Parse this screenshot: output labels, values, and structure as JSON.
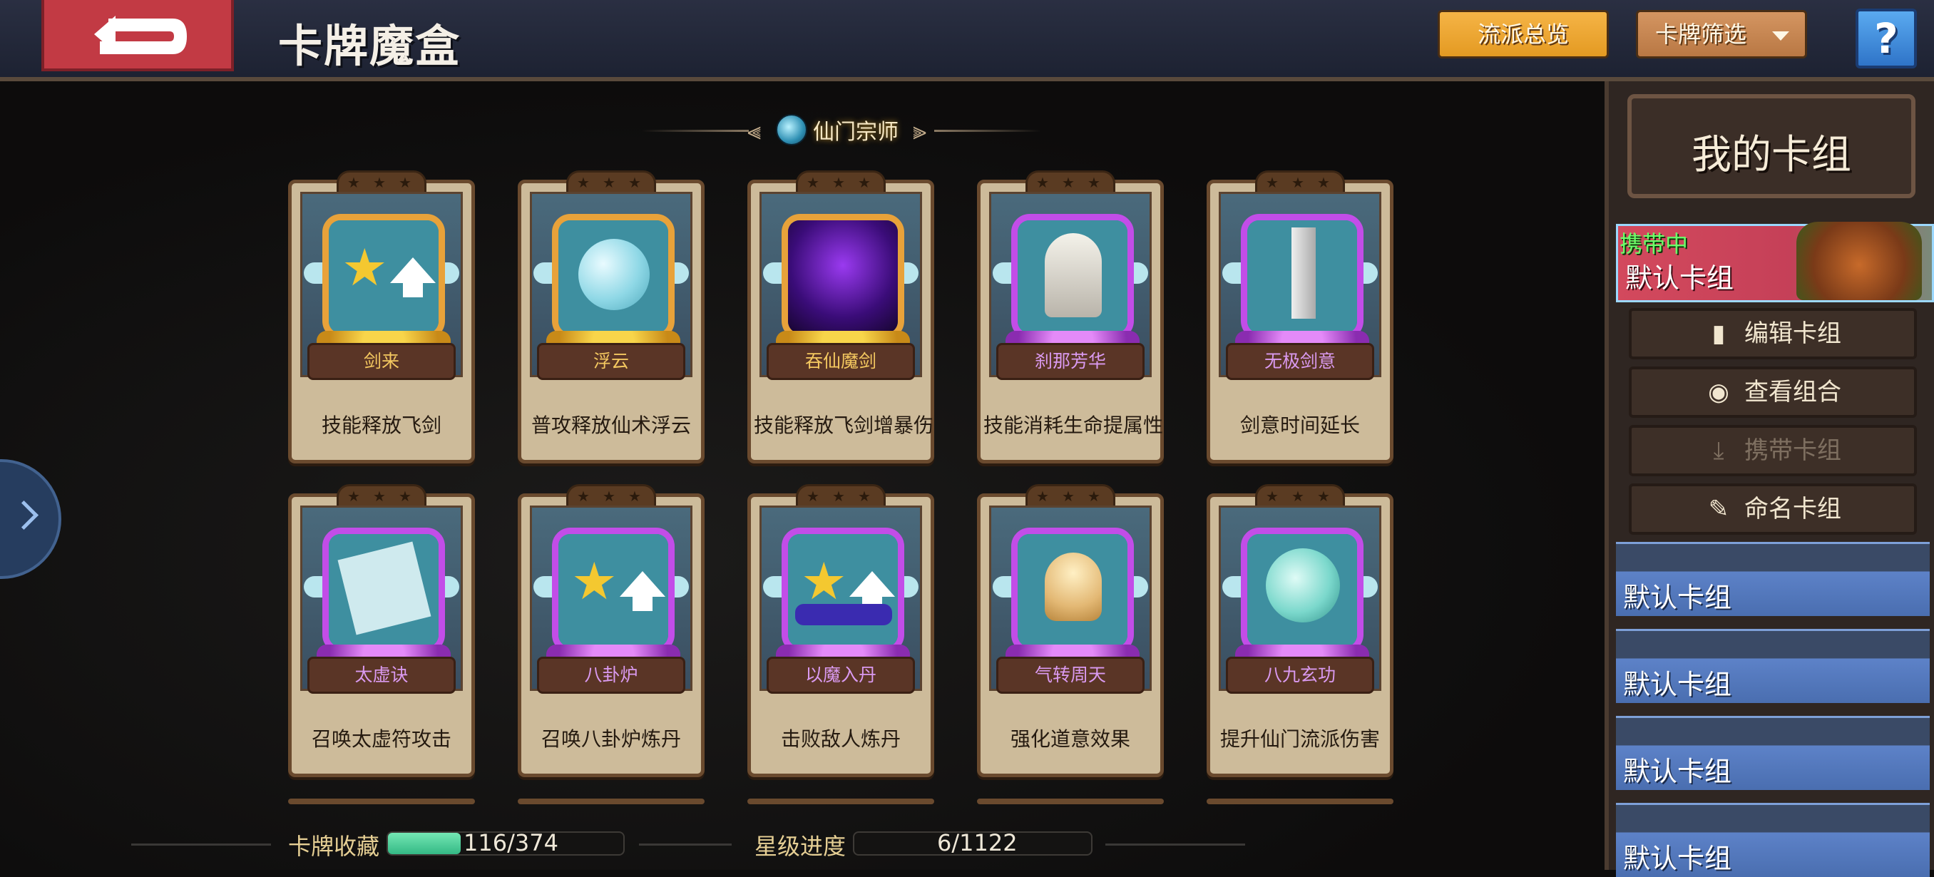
{
  "header": {
    "title": "卡牌魔盒",
    "overview_button": "流派总览",
    "filter_button": "卡牌筛选",
    "help_label": "?"
  },
  "section": {
    "title": "仙门宗师"
  },
  "cards": [
    {
      "name": "剑来",
      "desc": "技能释放飞剑",
      "frame": "gold",
      "icon": "star-arrow-icon"
    },
    {
      "name": "浮云",
      "desc": "普攻释放仙术浮云",
      "frame": "gold",
      "icon": "cloud-swirl-icon"
    },
    {
      "name": "吞仙魔剑",
      "desc": "技能释放飞剑增暴伤",
      "frame": "gold",
      "icon": "demon-sword-icon"
    },
    {
      "name": "刹那芳华",
      "desc": "技能消耗生命提属性",
      "frame": "purple",
      "icon": "white-sage-icon"
    },
    {
      "name": "无极剑意",
      "desc": "剑意时间延长",
      "frame": "purple",
      "icon": "sword-icon"
    },
    {
      "name": "太虚诀",
      "desc": "召唤太虚符攻击",
      "frame": "purple",
      "icon": "talisman-scroll-icon"
    },
    {
      "name": "八卦炉",
      "desc": "召唤八卦炉炼丹",
      "frame": "purple",
      "icon": "star-arrow-icon"
    },
    {
      "name": "以魔入丹",
      "desc": "击败敌人炼丹",
      "frame": "purple",
      "icon": "star-arrow-wave-icon"
    },
    {
      "name": "气转周天",
      "desc": "强化道意效果",
      "frame": "purple",
      "icon": "meditating-monk-icon"
    },
    {
      "name": "八九玄功",
      "desc": "提升仙门流派伤害",
      "frame": "purple",
      "icon": "jade-orb-icon"
    }
  ],
  "status": {
    "collection_label": "卡牌收藏",
    "collection_value": "116/374",
    "collection_progress": 0.31,
    "star_label": "星级进度",
    "star_value": "6/1122",
    "star_progress": 0.005
  },
  "panel": {
    "title": "我的卡组",
    "active_deck": {
      "tag": "携带中",
      "name": "默认卡组"
    },
    "buttons": [
      {
        "label": "编辑卡组",
        "icon": "cards-icon",
        "enabled": true
      },
      {
        "label": "查看组合",
        "icon": "eye-icon",
        "enabled": true
      },
      {
        "label": "携带卡组",
        "icon": "download-icon",
        "enabled": false
      },
      {
        "label": "命名卡组",
        "icon": "pencil-icon",
        "enabled": true
      }
    ],
    "decks": [
      "默认卡组",
      "默认卡组",
      "默认卡组",
      "默认卡组"
    ]
  },
  "colors": {
    "accent_gold": "#e8a23a",
    "accent_purple": "#c24de8",
    "active_deck_red": "#d3495d",
    "deck_blue": "#5d82c8",
    "progress_green": "#34b985"
  }
}
